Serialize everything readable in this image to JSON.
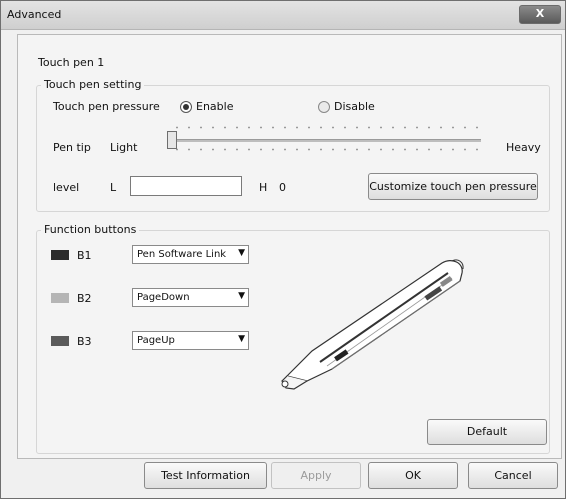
{
  "window": {
    "title": "Advanced",
    "close_label": "X"
  },
  "pen": {
    "name": "Touch pen 1"
  },
  "touch_setting": {
    "group_title": "Touch pen setting",
    "pressure_label": "Touch pen pressure",
    "enable_label": "Enable",
    "disable_label": "Disable",
    "selected": "Enable",
    "pen_tip_label": "Pen tip",
    "light_label": "Light",
    "heavy_label": "Heavy",
    "slider_value": 0,
    "level_label": "level",
    "l_label": "L",
    "l_value": "",
    "h_label": "H",
    "h_value": "0",
    "customize_label": "Customize touch pen pressure"
  },
  "function_buttons": {
    "group_title": "Function buttons",
    "items": [
      {
        "label": "B1",
        "value": "Pen Software Link",
        "color": "#2b2b2b"
      },
      {
        "label": "B2",
        "value": "PageDown",
        "color": "#b5b5b5"
      },
      {
        "label": "B3",
        "value": "PageUp",
        "color": "#5a5a5a"
      }
    ],
    "default_label": "Default"
  },
  "footer": {
    "test_label": "Test Information",
    "apply_label": "Apply",
    "ok_label": "OK",
    "cancel_label": "Cancel"
  }
}
